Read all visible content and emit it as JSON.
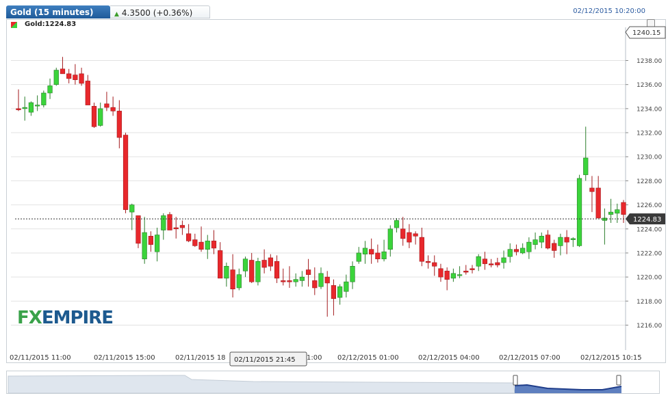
{
  "header": {
    "instrument_tab": "Gold (15 minutes)",
    "change_label": "4.3500 (+0.36%)",
    "timestamp": "02/12/2015 10:20:00",
    "legend_label": "Gold:1224.83"
  },
  "colors": {
    "up": "#3bd43b",
    "down": "#e8282c",
    "grid": "#e2e2e2",
    "accent": "#1e5a99"
  },
  "logo": {
    "part1": "FX",
    "part2": "EMPIRE"
  },
  "chart_data": {
    "type": "candlestick",
    "ylim": [
      1216,
      1240.15
    ],
    "y_ticks": [
      "1216.00",
      "1218.00",
      "1220.00",
      "1222.00",
      "1224.00",
      "1226.00",
      "1228.00",
      "1230.00",
      "1232.00",
      "1234.00",
      "1236.00",
      "1238.00"
    ],
    "x_ticks": [
      "02/11/2015 11:00",
      "02/11/2015 15:00",
      "02/11/2015 18",
      "02/12/2015 01:00",
      "02/12/2015 04:00",
      "02/12/2015 07:00",
      "02/12/2015 10:15"
    ],
    "crosshair_x_label": "02/11/2015 21:45",
    "crosshair_x_suffix": "1:00",
    "last_price_label": "1224.83",
    "max_label": "1240.15",
    "last_price": 1224.83,
    "candles": [
      [
        1234.0,
        1235.6,
        1233.8,
        1233.9
      ],
      [
        1234.0,
        1235.0,
        1233.0,
        1234.1
      ],
      [
        1233.7,
        1234.6,
        1233.4,
        1234.5
      ],
      [
        1234.3,
        1235.1,
        1233.8,
        1234.3
      ],
      [
        1234.3,
        1235.5,
        1234.1,
        1235.3
      ],
      [
        1235.3,
        1236.5,
        1234.8,
        1235.9
      ],
      [
        1236.0,
        1237.4,
        1235.9,
        1237.2
      ],
      [
        1237.3,
        1238.3,
        1236.9,
        1236.9
      ],
      [
        1236.9,
        1237.3,
        1236.1,
        1236.5
      ],
      [
        1236.8,
        1237.7,
        1236.0,
        1236.4
      ],
      [
        1236.9,
        1237.4,
        1235.9,
        1236.1
      ],
      [
        1236.3,
        1236.8,
        1234.5,
        1234.3
      ],
      [
        1234.2,
        1234.5,
        1232.4,
        1232.5
      ],
      [
        1232.6,
        1234.5,
        1232.5,
        1234.0
      ],
      [
        1234.4,
        1235.4,
        1233.8,
        1234.1
      ],
      [
        1234.1,
        1235.0,
        1233.4,
        1233.8
      ],
      [
        1233.8,
        1234.7,
        1230.7,
        1231.6
      ],
      [
        1231.8,
        1232.0,
        1225.3,
        1225.6
      ],
      [
        1225.4,
        1226.1,
        1223.9,
        1226.0
      ],
      [
        1225.1,
        1225.1,
        1222.4,
        1222.8
      ],
      [
        1221.5,
        1225.0,
        1221.1,
        1223.7
      ],
      [
        1223.4,
        1223.8,
        1222.1,
        1222.7
      ],
      [
        1222.1,
        1224.1,
        1221.3,
        1223.5
      ],
      [
        1223.9,
        1225.3,
        1223.1,
        1225.1
      ],
      [
        1225.2,
        1225.4,
        1223.9,
        1223.9
      ],
      [
        1224.1,
        1225.0,
        1223.2,
        1224.0
      ],
      [
        1224.3,
        1224.7,
        1223.5,
        1224.1
      ],
      [
        1223.6,
        1224.4,
        1222.9,
        1223.0
      ],
      [
        1223.1,
        1223.6,
        1222.5,
        1222.6
      ],
      [
        1222.9,
        1224.2,
        1222.1,
        1222.3
      ],
      [
        1222.3,
        1223.5,
        1221.5,
        1223.0
      ],
      [
        1223.0,
        1223.9,
        1221.9,
        1222.4
      ],
      [
        1222.2,
        1222.9,
        1220.9,
        1219.9
      ],
      [
        1219.9,
        1221.2,
        1219.2,
        1220.9
      ],
      [
        1220.6,
        1221.9,
        1218.3,
        1219.0
      ],
      [
        1219.1,
        1220.7,
        1218.9,
        1220.2
      ],
      [
        1220.5,
        1221.7,
        1220.0,
        1221.5
      ],
      [
        1221.4,
        1222.0,
        1219.5,
        1219.6
      ],
      [
        1219.6,
        1221.6,
        1219.3,
        1221.3
      ],
      [
        1221.4,
        1222.3,
        1220.3,
        1220.8
      ],
      [
        1221.6,
        1221.9,
        1220.5,
        1220.9
      ],
      [
        1221.3,
        1221.8,
        1219.5,
        1219.9
      ],
      [
        1219.7,
        1220.7,
        1219.3,
        1219.6
      ],
      [
        1219.7,
        1220.9,
        1219.1,
        1219.6
      ],
      [
        1219.6,
        1220.3,
        1219.2,
        1219.8
      ],
      [
        1219.7,
        1220.5,
        1219.2,
        1220.0
      ],
      [
        1220.6,
        1221.5,
        1219.2,
        1220.2
      ],
      [
        1219.7,
        1220.8,
        1218.5,
        1219.1
      ],
      [
        1219.2,
        1220.8,
        1219.0,
        1220.3
      ],
      [
        1220.0,
        1220.5,
        1216.7,
        1219.5
      ],
      [
        1219.3,
        1219.8,
        1216.8,
        1218.2
      ],
      [
        1218.3,
        1219.4,
        1217.7,
        1219.2
      ],
      [
        1218.8,
        1220.2,
        1218.3,
        1219.6
      ],
      [
        1219.6,
        1221.3,
        1219.0,
        1220.9
      ],
      [
        1221.3,
        1222.5,
        1221.1,
        1222.0
      ],
      [
        1221.9,
        1223.0,
        1221.1,
        1222.4
      ],
      [
        1222.3,
        1223.2,
        1221.1,
        1221.9
      ],
      [
        1222.0,
        1222.7,
        1221.2,
        1221.5
      ],
      [
        1221.5,
        1223.1,
        1221.3,
        1222.1
      ],
      [
        1222.3,
        1224.3,
        1221.7,
        1224.0
      ],
      [
        1224.1,
        1224.9,
        1223.7,
        1224.7
      ],
      [
        1224.0,
        1225.0,
        1222.6,
        1223.2
      ],
      [
        1223.7,
        1224.4,
        1222.4,
        1222.9
      ],
      [
        1223.6,
        1223.8,
        1222.7,
        1223.4
      ],
      [
        1223.3,
        1224.1,
        1220.9,
        1221.3
      ],
      [
        1221.3,
        1221.8,
        1220.7,
        1221.2
      ],
      [
        1221.2,
        1221.8,
        1220.1,
        1220.9
      ],
      [
        1220.7,
        1221.1,
        1219.6,
        1220.0
      ],
      [
        1220.5,
        1220.8,
        1218.9,
        1219.8
      ],
      [
        1219.9,
        1220.7,
        1219.6,
        1220.3
      ],
      [
        1220.2,
        1220.9,
        1219.9,
        1220.2
      ],
      [
        1220.5,
        1221.0,
        1220.2,
        1220.4
      ],
      [
        1220.7,
        1221.0,
        1220.3,
        1220.6
      ],
      [
        1220.9,
        1221.9,
        1220.5,
        1221.7
      ],
      [
        1221.5,
        1222.1,
        1220.6,
        1221.1
      ],
      [
        1221.1,
        1221.5,
        1220.8,
        1221.0
      ],
      [
        1221.2,
        1221.6,
        1220.8,
        1221.0
      ],
      [
        1221.2,
        1222.2,
        1220.7,
        1221.6
      ],
      [
        1221.7,
        1222.8,
        1221.2,
        1222.3
      ],
      [
        1222.3,
        1222.7,
        1221.8,
        1222.1
      ],
      [
        1222.0,
        1222.8,
        1221.9,
        1222.4
      ],
      [
        1222.1,
        1223.3,
        1221.5,
        1222.9
      ],
      [
        1222.7,
        1223.7,
        1222.3,
        1223.1
      ],
      [
        1222.9,
        1223.7,
        1222.4,
        1223.4
      ],
      [
        1223.5,
        1223.9,
        1222.3,
        1222.4
      ],
      [
        1222.8,
        1223.1,
        1221.6,
        1222.2
      ],
      [
        1222.6,
        1223.6,
        1221.8,
        1223.3
      ],
      [
        1223.3,
        1223.9,
        1221.9,
        1222.9
      ],
      [
        1223.1,
        1223.3,
        1222.5,
        1223.2
      ],
      [
        1222.6,
        1228.5,
        1222.5,
        1228.2
      ],
      [
        1228.5,
        1232.5,
        1228.0,
        1229.9
      ],
      [
        1227.4,
        1228.4,
        1225.4,
        1227.1
      ],
      [
        1227.4,
        1228.4,
        1225.4,
        1224.9
      ],
      [
        1224.7,
        1225.7,
        1222.7,
        1224.9
      ],
      [
        1225.2,
        1226.5,
        1224.5,
        1225.4
      ],
      [
        1225.3,
        1226.1,
        1224.5,
        1225.6
      ],
      [
        1226.2,
        1226.4,
        1224.5,
        1225.2
      ]
    ]
  }
}
